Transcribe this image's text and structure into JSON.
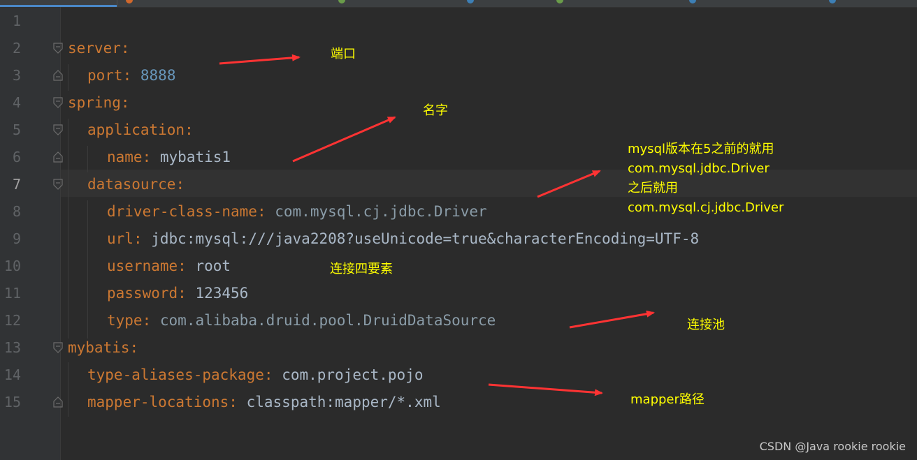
{
  "editor": {
    "line_numbers": [
      "1",
      "2",
      "3",
      "4",
      "5",
      "6",
      "7",
      "8",
      "9",
      "10",
      "11",
      "12",
      "13",
      "14",
      "15"
    ],
    "current_line": "7",
    "lines": [
      {
        "key": "",
        "val": "",
        "val_type": ""
      },
      {
        "key": "server",
        "val": "",
        "val_type": ""
      },
      {
        "key": "port",
        "val": "8888",
        "val_type": "number"
      },
      {
        "key": "spring",
        "val": "",
        "val_type": ""
      },
      {
        "key": "application",
        "val": "",
        "val_type": ""
      },
      {
        "key": "name",
        "val": "mybatis1",
        "val_type": "text"
      },
      {
        "key": "datasource",
        "val": "",
        "val_type": ""
      },
      {
        "key": "driver-class-name",
        "val": "com.mysql.cj.jdbc.Driver",
        "val_type": "class"
      },
      {
        "key": "url",
        "val": "jdbc:mysql:///java2208?useUnicode=true&characterEncoding=UTF-8",
        "val_type": "text"
      },
      {
        "key": "username",
        "val": "root",
        "val_type": "text"
      },
      {
        "key": "password",
        "val": "123456",
        "val_type": "text"
      },
      {
        "key": "type",
        "val": "com.alibaba.druid.pool.DruidDataSource",
        "val_type": "class"
      },
      {
        "key": "mybatis",
        "val": "",
        "val_type": ""
      },
      {
        "key": "type-aliases-package",
        "val": "com.project.pojo",
        "val_type": "text"
      },
      {
        "key": "mapper-locations",
        "val": "classpath:mapper/*.xml",
        "val_type": "text"
      }
    ]
  },
  "annotations": {
    "port": "端口",
    "name": "名字",
    "driver_lines": [
      "mysql版本在5之前的就用",
      "com.mysql.jdbc.Driver",
      "之后就用",
      "com.mysql.cj.jdbc.Driver"
    ],
    "connection": "连接四要素",
    "pool": "连接池",
    "mapper": "mapper路径"
  },
  "watermark": "CSDN @Java rookie rookie",
  "colors": {
    "background": "#2b2b2b",
    "key": "#cc7832",
    "number": "#6897bb",
    "annotation": "#ffff00",
    "arrow": "#ff3333"
  }
}
